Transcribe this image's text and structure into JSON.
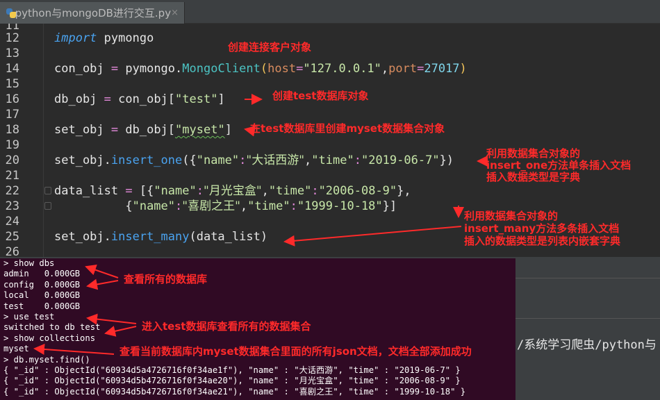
{
  "tab": {
    "filename": "python与mongoDB进行交互.py",
    "close": "×"
  },
  "editor": {
    "lines": [
      {
        "num": "11"
      },
      {
        "num": "12"
      },
      {
        "num": "13"
      },
      {
        "num": "14"
      },
      {
        "num": "15"
      },
      {
        "num": "16"
      },
      {
        "num": "17"
      },
      {
        "num": "18"
      },
      {
        "num": "19"
      },
      {
        "num": "20"
      },
      {
        "num": "21"
      },
      {
        "num": "22"
      },
      {
        "num": "23"
      },
      {
        "num": "24"
      },
      {
        "num": "25"
      },
      {
        "num": "26"
      }
    ],
    "code": {
      "l12_kw": "import",
      "l12_rest": " pymongo",
      "l14_a": "con_obj ",
      "l14_eq": "=",
      "l14_b": " pymongo.",
      "l14_cls": "MongoClient",
      "l14_p1": "(",
      "l14_host": "host",
      "l14_eq2": "=",
      "l14_hostval": "\"127.0.0.1\"",
      "l14_comma": ",",
      "l14_port": "port",
      "l14_eq3": "=",
      "l14_portval": "27017",
      "l14_p2": ")",
      "l16_a": "db_obj ",
      "l16_eq": "=",
      "l16_b": " con_obj[",
      "l16_str": "\"test\"",
      "l16_c": "]",
      "l18_a": "set_obj ",
      "l18_eq": "=",
      "l18_b": " db_obj[",
      "l18_str": "\"myset\"",
      "l18_c": "]",
      "l20_a": "set_obj.",
      "l20_fn": "insert_one",
      "l20_b": "({",
      "l20_k1": "\"name\"",
      "l20_colon1": ":",
      "l20_v1": "\"大话西游\"",
      "l20_c1": ",",
      "l20_k2": "\"time\"",
      "l20_colon2": ":",
      "l20_v2": "\"2019-06-7\"",
      "l20_end": "})",
      "l22_a": "data_list ",
      "l22_eq": "=",
      "l22_b": " [{",
      "l22_k1": "\"name\"",
      "l22_colon1": ":",
      "l22_v1": "\"月光宝盒\"",
      "l22_c1": ",",
      "l22_k2": "\"time\"",
      "l22_colon2": ":",
      "l22_v2": "\"2006-08-9\"",
      "l22_end": "},",
      "l23_a": "          {",
      "l23_k1": "\"name\"",
      "l23_colon1": ":",
      "l23_v1": "\"喜剧之王\"",
      "l23_c1": ",",
      "l23_k2": "\"time\"",
      "l23_colon2": ":",
      "l23_v2": "\"1999-10-18\"",
      "l23_end": "}]",
      "l25_a": "set_obj.",
      "l25_fn": "insert_many",
      "l25_b": "(data_list)"
    }
  },
  "annotations": {
    "create_client": "创建连接客户对象",
    "create_db": "创建test数据库对象",
    "create_collection": "在test数据库里创建myset数据集合对象",
    "insert_one_1": "利用数据集合对象的",
    "insert_one_2": "insert_one方法单条插入文档",
    "insert_one_3": "插入数据类型是字典",
    "insert_many_1": "利用数据集合对象的",
    "insert_many_2": "insert_many方法多条插入文档",
    "insert_many_3": "插入的数据类型是列表内嵌套字典",
    "show_dbs": "查看所有的数据库",
    "use_test": "进入test数据库查看所有的数据集合",
    "find_all": "查看当前数据库内myset数据集合里面的所有json文档，文档全部添加成功"
  },
  "terminal": {
    "lines": [
      "> show dbs",
      "admin   0.000GB",
      "config  0.000GB",
      "local   0.000GB",
      "test    0.000GB",
      "> use test",
      "switched to db test",
      "> show collections",
      "myset",
      "> db.myset.find()"
    ],
    "docs": [
      {
        "pre": "{ \"_id\" : ObjectId(\"60934d5a4726716f0f34ae1f\"), \"name\" : \"",
        "name": "大话西游",
        "post": "\", \"time\" : \"2019-06-7\" }"
      },
      {
        "pre": "{ \"_id\" : ObjectId(\"60934d5b4726716f0f34ae20\"), \"name\" : \"",
        "name": "月光宝盒",
        "post": "\", \"time\" : \"2006-08-9\" }"
      },
      {
        "pre": "{ \"_id\" : ObjectId(\"60934d5b4726716f0f34ae21\"), \"name\" : \"",
        "name": "喜剧之王",
        "post": "\", \"time\" : \"1999-10-18\" }"
      }
    ]
  },
  "background_path": "/系统学习爬虫/python与"
}
